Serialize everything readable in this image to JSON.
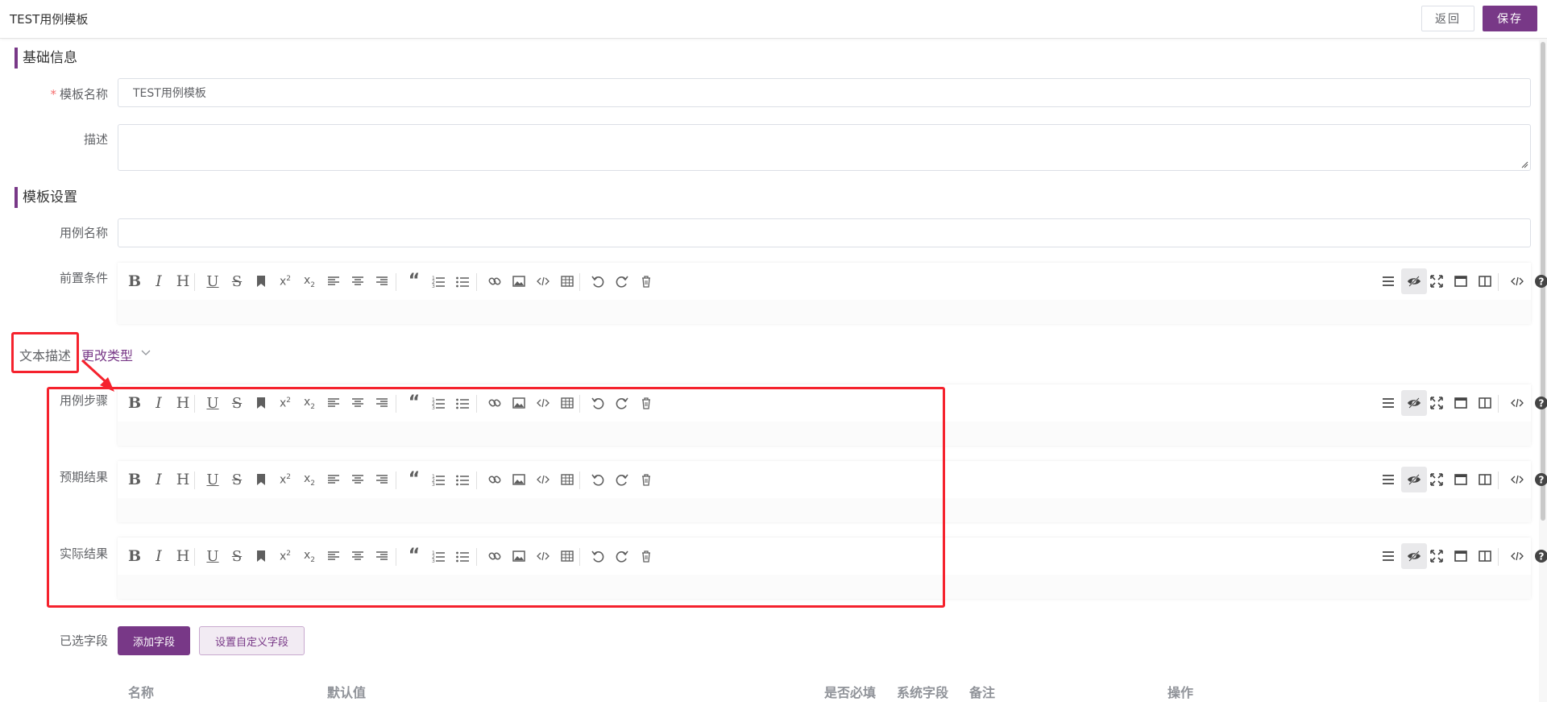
{
  "header": {
    "title": "TEST用例模板",
    "back_label": "返回",
    "save_label": "保存"
  },
  "basic_info": {
    "section_title": "基础信息",
    "name_label": "模板名称",
    "name_value": "TEST用例模板",
    "desc_label": "描述"
  },
  "template_settings": {
    "section_title": "模板设置",
    "case_name_label": "用例名称",
    "precondition_label": "前置条件",
    "text_type_label": "文本描述",
    "change_type_label": "更改类型",
    "steps_label": "用例步骤",
    "expected_label": "预期结果",
    "actual_label": "实际结果",
    "selected_fields_label": "已选字段",
    "add_field_label": "添加字段",
    "custom_field_label": "设置自定义字段"
  },
  "table": {
    "columns": [
      "名称",
      "默认值",
      "是否必填",
      "系统字段",
      "备注",
      "操作"
    ]
  },
  "toolbar_icons": {
    "left": [
      "bold-icon",
      "italic-icon",
      "heading-icon",
      "underline-icon",
      "strikethrough-icon",
      "mark-icon",
      "superscript-icon",
      "subscript-icon",
      "align-left-icon",
      "align-center-icon",
      "align-right-icon",
      "quote-icon",
      "ordered-list-icon",
      "unordered-list-icon",
      "link-icon",
      "image-icon",
      "code-icon",
      "table-icon",
      "undo-icon",
      "redo-icon",
      "trash-icon"
    ],
    "right": [
      "menu-icon",
      "eye-icon",
      "fullscreen-icon",
      "window-icon",
      "split-view-icon",
      "html-code-icon",
      "help-icon"
    ]
  },
  "colors": {
    "brand": "#783887",
    "annotation": "#f5222d"
  }
}
